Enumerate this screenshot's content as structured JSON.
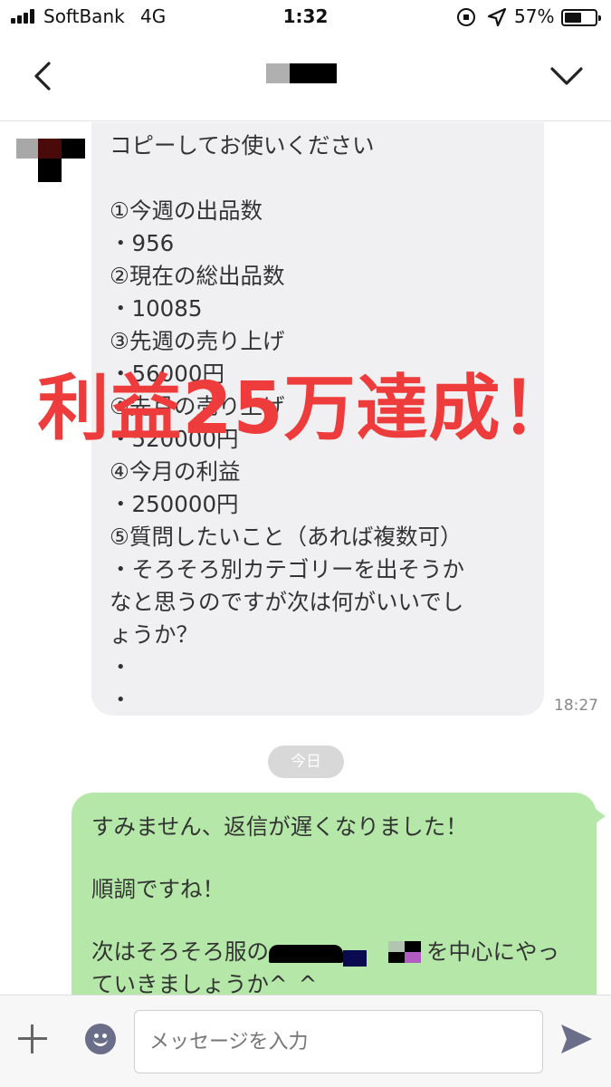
{
  "status_bar": {
    "carrier": "SoftBank",
    "network": "4G",
    "time": "1:32",
    "battery_percent": "57%",
    "battery_level": 0.57,
    "icons": [
      "signal-icon",
      "rotation-lock-icon",
      "location-icon",
      "battery-icon"
    ]
  },
  "header": {
    "back_icon": "chevron-left-icon",
    "menu_icon": "chevron-down-icon"
  },
  "incoming_message": {
    "lines": [
      "コピーしてお使いください",
      "",
      "①今週の出品数",
      "・956",
      "②現在の総出品数",
      "・10085",
      "③先週の売り上げ",
      "・56000円",
      "④先月の売り上げ",
      "・520000円",
      "④今月の利益",
      "・250000円",
      "⑤質問したいこと（あれば複数可）",
      "・そろそろ別カテゴリーを出そうか",
      "なと思うのですが次は何がいいでし",
      "ょうか？",
      "・",
      "・"
    ],
    "time": "18:27"
  },
  "date_divider": "今日",
  "outgoing_message": {
    "line1": "すみません、返信が遅くなりました！",
    "line2": "順調ですね！",
    "line3_prefix": "次はそろそろ服の",
    "line3_suffix": "を中心にやっ",
    "line4": "ていきましょうか^_^"
  },
  "overlay_text": "利益25万達成！",
  "input_bar": {
    "placeholder": "メッセージを入力",
    "icons": [
      "plus-icon",
      "emoji-icon",
      "send-icon"
    ]
  },
  "colors": {
    "incoming_bubble": "#f0f0f2",
    "outgoing_bubble": "#b5e8a8",
    "overlay_text": "#ee3c3c"
  }
}
